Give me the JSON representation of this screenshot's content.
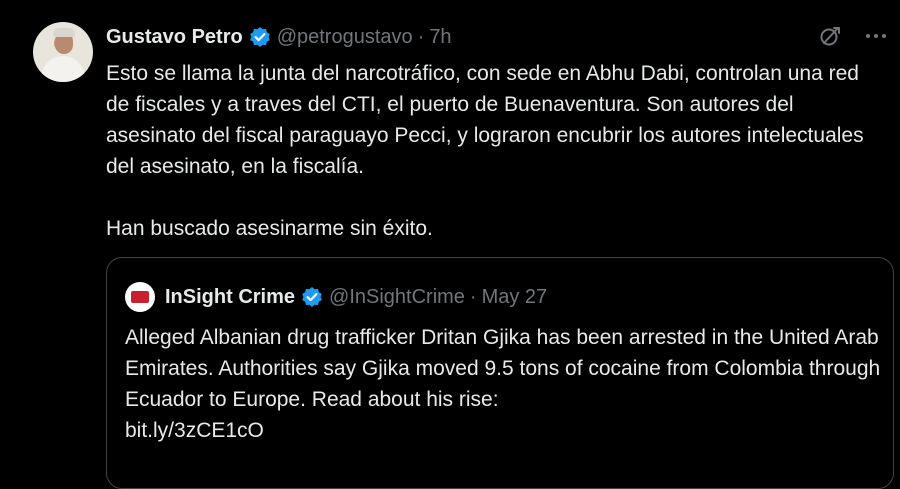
{
  "colors": {
    "background": "#000000",
    "text_primary": "#e7e9ea",
    "text_secondary": "#71767b",
    "verified_blue": "#1d9bf0",
    "border": "#3f4448"
  },
  "post": {
    "author_name": "Gustavo Petro",
    "author_handle": "@petrogustavo",
    "separator": "·",
    "time": "7h",
    "icons": [
      "verified-badge-icon",
      "grok-icon",
      "more-icon"
    ],
    "paragraphs": [
      "Esto se llama la junta del narcotráfico, con sede en Abhu Dabi, controlan una red de fiscales y a traves del CTI, el puerto de Buenaventura. Son autores del asesinato del fiscal paraguayo Pecci, y lograron encubrir los autores intelectuales del asesinato, en la fiscalía.",
      "Han buscado asesinarme sin éxito."
    ]
  },
  "quoted_post": {
    "author_name": "InSight Crime",
    "author_handle": "@InSightCrime",
    "separator": "·",
    "time": "May 27",
    "text": "Alleged Albanian drug trafficker Dritan Gjika has been arrested in the United Arab Emirates. Authorities say Gjika moved 9.5 tons of cocaine from Colombia through Ecuador to Europe. Read about his rise:",
    "link": "bit.ly/3zCE1cO"
  }
}
